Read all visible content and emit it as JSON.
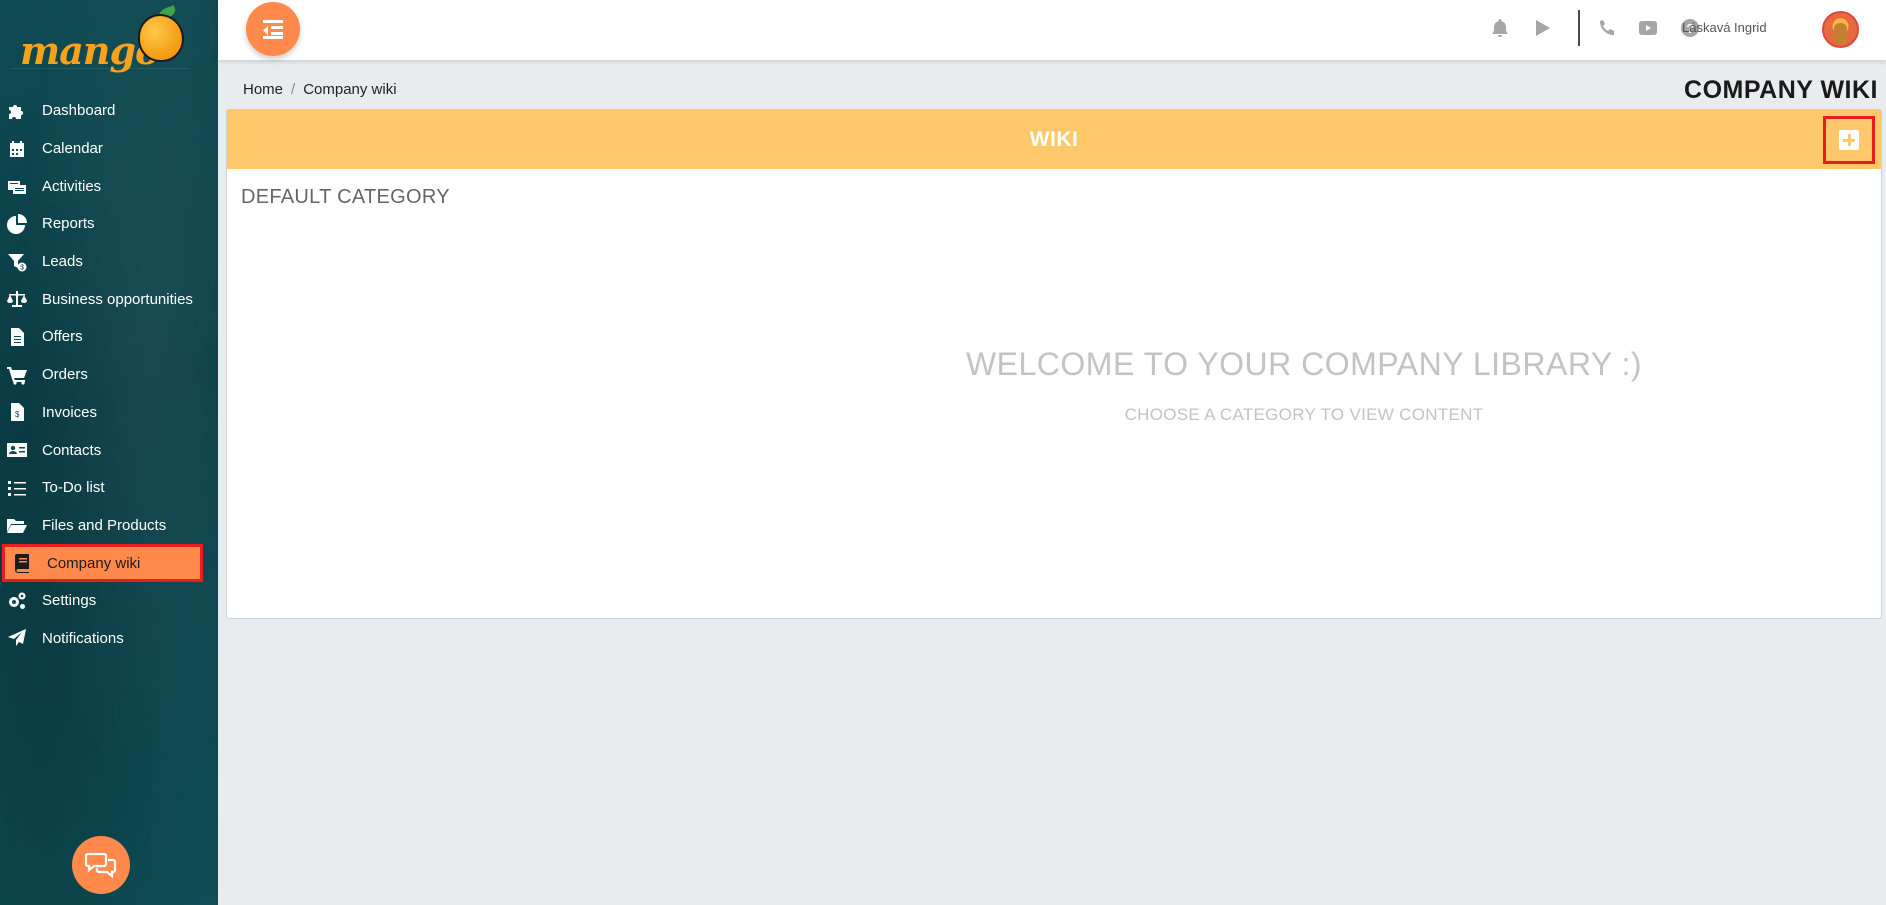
{
  "brand": {
    "logo_text": "mango"
  },
  "sidebar": {
    "items": [
      {
        "label": "Dashboard",
        "icon": "puzzle-icon"
      },
      {
        "label": "Calendar",
        "icon": "calendar-icon"
      },
      {
        "label": "Activities",
        "icon": "activities-icon"
      },
      {
        "label": "Reports",
        "icon": "pie-chart-icon"
      },
      {
        "label": "Leads",
        "icon": "funnel-icon"
      },
      {
        "label": "Business opportunities",
        "icon": "scale-icon"
      },
      {
        "label": "Offers",
        "icon": "document-icon"
      },
      {
        "label": "Orders",
        "icon": "cart-icon"
      },
      {
        "label": "Invoices",
        "icon": "invoice-icon"
      },
      {
        "label": "Contacts",
        "icon": "contact-card-icon"
      },
      {
        "label": "To-Do list",
        "icon": "checklist-icon"
      },
      {
        "label": "Files and Products",
        "icon": "folder-open-icon"
      },
      {
        "label": "Company wiki",
        "icon": "book-icon",
        "active": true
      },
      {
        "label": "Settings",
        "icon": "gears-icon"
      },
      {
        "label": "Notifications",
        "icon": "paper-plane-icon"
      }
    ]
  },
  "topbar": {
    "icons": [
      "bell-icon",
      "play-icon",
      "phone-icon",
      "youtube-icon",
      "help-icon"
    ],
    "user_name": "Láskavá Ingrid"
  },
  "breadcrumb": {
    "home": "Home",
    "separator": "/",
    "current": "Company wiki"
  },
  "page_title": "COMPANY WIKI",
  "wiki": {
    "header_title": "WIKI",
    "category_title": "DEFAULT CATEGORY",
    "welcome_title": "WELCOME TO YOUR COMPANY LIBRARY :)",
    "welcome_subtitle": "CHOOSE A CATEGORY TO VIEW CONTENT"
  },
  "colors": {
    "accent": "#ff8a4c",
    "wiki_header": "#ffc96b",
    "sidebar_bg": "#0e4a52",
    "highlight_border": "#e81d1d"
  }
}
